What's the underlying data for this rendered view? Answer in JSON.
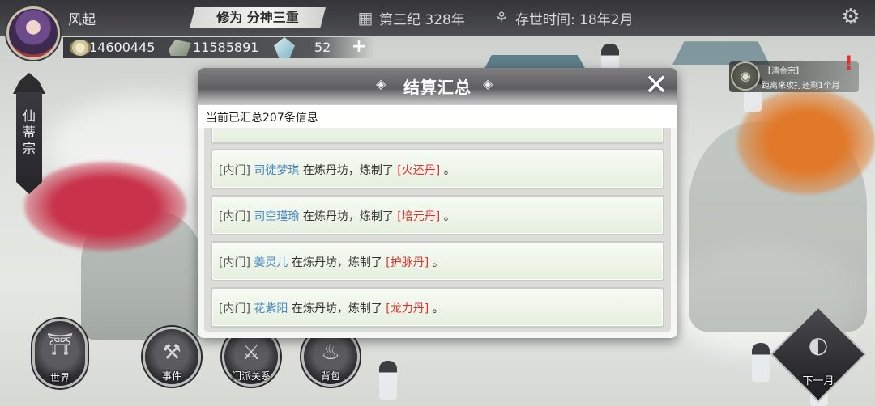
{
  "player": {
    "name": "风起",
    "realm": "修为 分神三重",
    "era": "第三纪 328年",
    "lifetime": "存世时间: 18年2月"
  },
  "resources": {
    "spirit_stones": "14600445",
    "materials": "11585891",
    "crystals": "52",
    "add_label": "+"
  },
  "sect": {
    "name": "仙蒂宗"
  },
  "notice": {
    "title": "【清金宗】",
    "text": "距离来攻打还剩1个月",
    "alert": "!"
  },
  "bottom_nav": [
    {
      "label": "世界",
      "icon": "world-icon"
    },
    {
      "label": "事件",
      "icon": "event-icon"
    },
    {
      "label": "门派关系",
      "icon": "relations-icon"
    },
    {
      "label": "背包",
      "icon": "bag-icon"
    }
  ],
  "next_month": {
    "label": "下一月"
  },
  "dialog": {
    "title": "结算汇总",
    "summary": "当前已汇总207条信息",
    "entries": [
      {
        "tag": "[内门]",
        "name": "司徒梦琪",
        "mid": "在炼丹坊，炼制了",
        "item": "[火还丹]",
        "end": "。"
      },
      {
        "tag": "[内门]",
        "name": "司空瑾瑜",
        "mid": "在炼丹坊，炼制了",
        "item": "[培元丹]",
        "end": "。"
      },
      {
        "tag": "[内门]",
        "name": "姜灵儿",
        "mid": "在炼丹坊，炼制了",
        "item": "[护脉丹]",
        "end": "。"
      },
      {
        "tag": "[内门]",
        "name": "花紫阳",
        "mid": "在炼丹坊，炼制了",
        "item": "[龙力丹]",
        "end": "。"
      }
    ]
  },
  "colors": {
    "name_blue": "#4a8ac4",
    "item_red": "#e0332e"
  }
}
